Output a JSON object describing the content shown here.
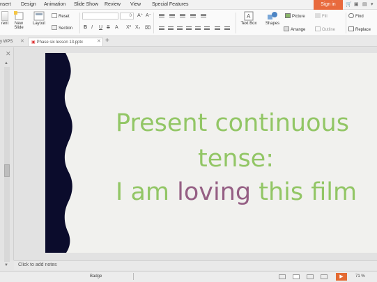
{
  "menu": [
    "nsert",
    "Design",
    "Animation",
    "Slide Show",
    "Review",
    "View",
    "Special Features"
  ],
  "signin_label": "Sign in",
  "ribbon": {
    "rent_label": "rent",
    "new_slide_label": "New Slide",
    "layout_label": "Layout",
    "reset_label": "Reset",
    "section_label": "Section",
    "font_size": "0",
    "text_box_label": "Text Box",
    "shapes_label": "Shapes",
    "picture_label": "Picture",
    "fill_label": "Fill",
    "arrange_label": "Arrange",
    "outline_label": "Outline",
    "find_label": "Find",
    "replace_label": "Replace",
    "format_buttons": [
      "B",
      "I",
      "U",
      "S",
      "A",
      "X²",
      "X₂"
    ]
  },
  "tabs": {
    "first": "y WPS",
    "active": "Phase six lesson 13.pptx"
  },
  "slide": {
    "line1": "Present continuous",
    "line2": "tense:",
    "line3_a": "I am ",
    "line3_b": "loving",
    "line3_c": " this film",
    "wave_color": "#0b0c2c",
    "text_green": "#92c665",
    "text_purple": "#955f84"
  },
  "notes_placeholder": "Click to add notes",
  "status": {
    "theme": "Badge",
    "zoom": "71 %"
  }
}
